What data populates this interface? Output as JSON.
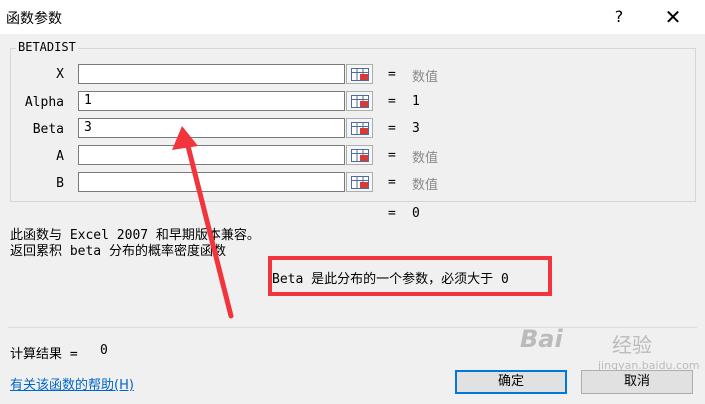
{
  "dialog": {
    "title": "函数参数",
    "help_glyph": "?",
    "close_glyph": "✕"
  },
  "function_group": {
    "name": "BETADIST",
    "args": [
      {
        "label": "X",
        "value": "",
        "eq": "=",
        "result": "数值",
        "result_placeholder": true
      },
      {
        "label": "Alpha",
        "value": "1",
        "eq": "=",
        "result": "1",
        "result_placeholder": false
      },
      {
        "label": "Beta",
        "value": "3",
        "eq": "=",
        "result": "3",
        "result_placeholder": false
      },
      {
        "label": "A",
        "value": "",
        "eq": "=",
        "result": "数值",
        "result_placeholder": true
      },
      {
        "label": "B",
        "value": "",
        "eq": "=",
        "result": "数值",
        "result_placeholder": true
      }
    ],
    "icons": {
      "ref": "range-select-icon"
    }
  },
  "formula_result": {
    "eq": "=",
    "value": "0"
  },
  "description": {
    "compat": "此函数与 Excel 2007 和早期版本兼容。",
    "summary": "返回累积 beta 分布的概率密度函数",
    "arg_help": "Beta  是此分布的一个参数，必须大于 0"
  },
  "calc_result": {
    "label": "计算结果 =",
    "value": "0"
  },
  "footer": {
    "help_link": "有关该函数的帮助(H)",
    "ok": "确定",
    "cancel": "取消"
  },
  "annotation": {
    "color": "#f2343c"
  },
  "watermark": {
    "text": "Bai",
    "cn": "经验",
    "url": "jingyan.baidu.com"
  }
}
